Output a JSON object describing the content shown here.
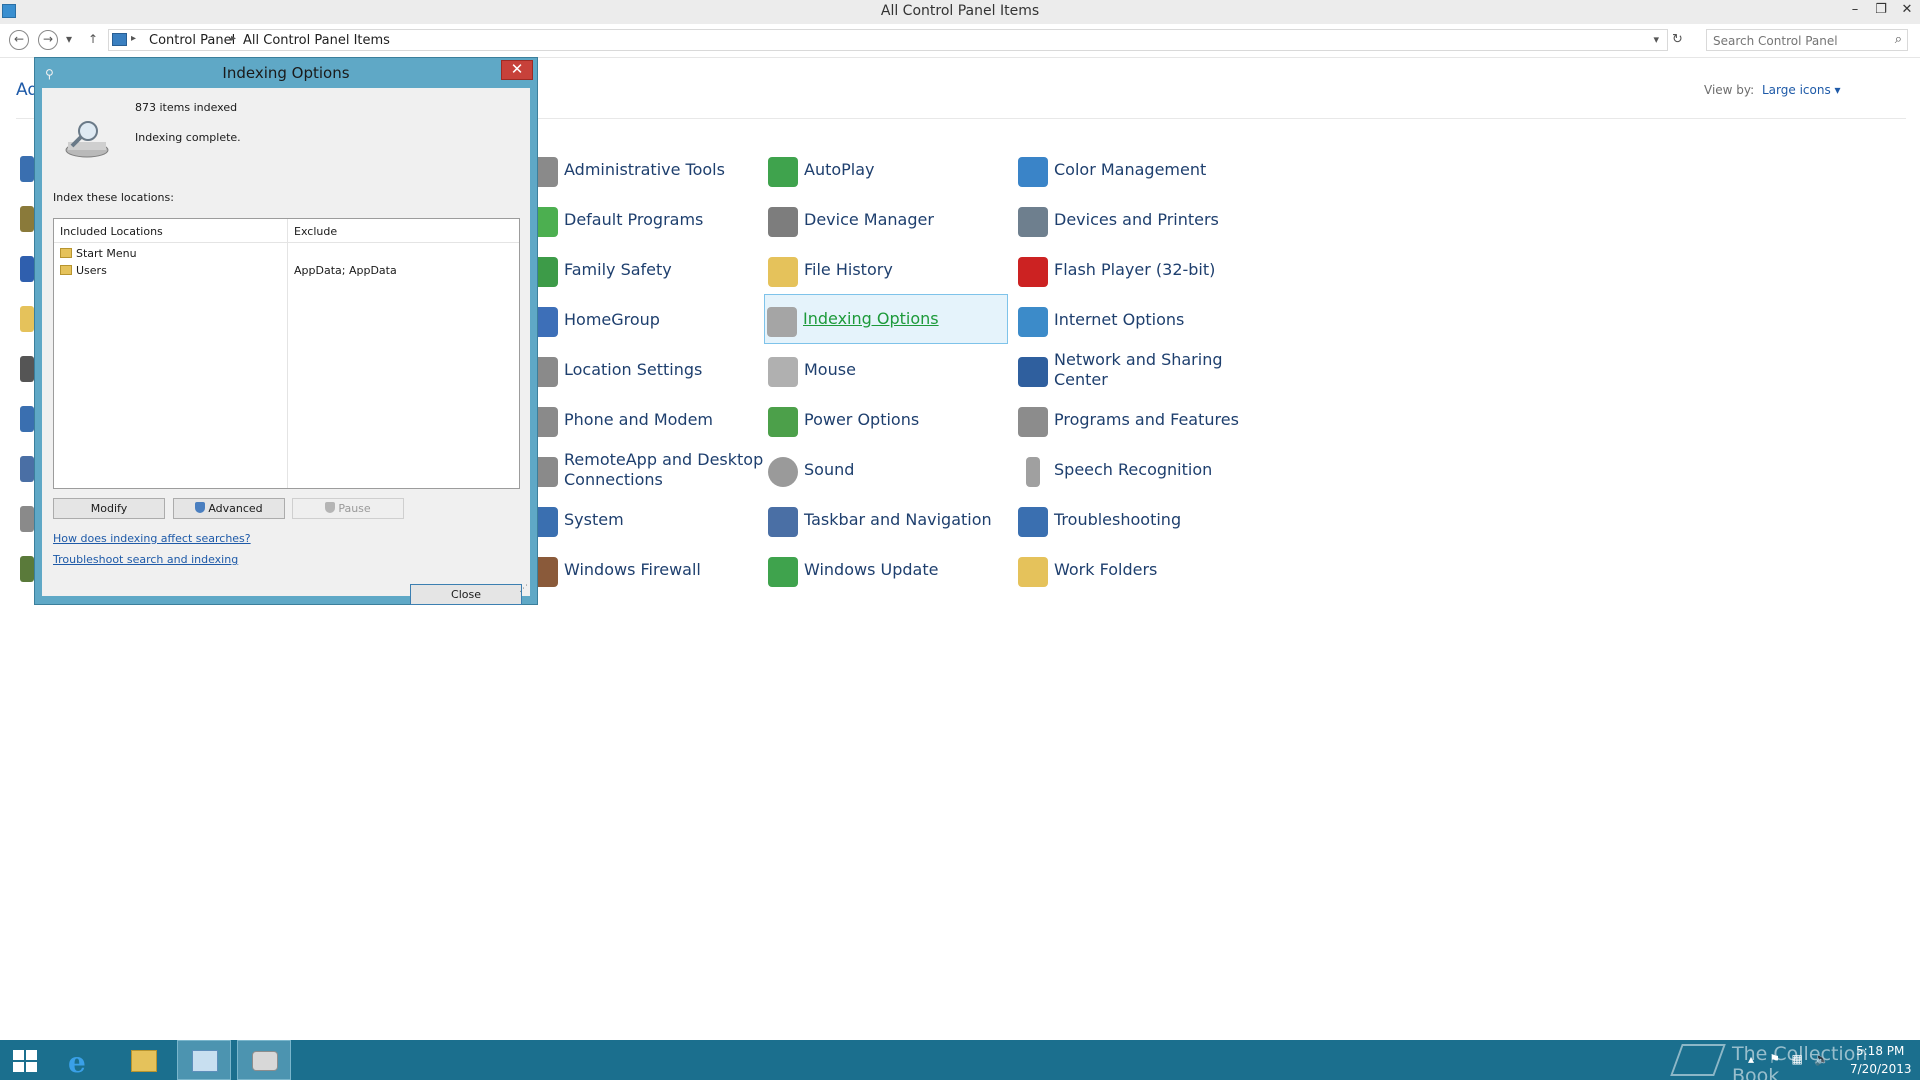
{
  "window": {
    "title": "All Control Panel Items"
  },
  "address": {
    "crumbs": [
      "Control Panel",
      "All Control Panel Items"
    ],
    "search_placeholder": "Search Control Panel"
  },
  "content": {
    "adjust_partial": "Ad",
    "view_by_label": "View by:",
    "view_by_value": "Large icons ▾"
  },
  "items": [
    {
      "label": "Administrative Tools",
      "icon": "administrative-tools-icon",
      "color": "#8a8a8a"
    },
    {
      "label": "AutoPlay",
      "icon": "autoplay-icon",
      "color": "#3fa34d"
    },
    {
      "label": "Color Management",
      "icon": "color-management-icon",
      "color": "#3a84c8"
    },
    {
      "label": "Default Programs",
      "icon": "default-programs-icon",
      "color": "#4caf50"
    },
    {
      "label": "Device Manager",
      "icon": "device-manager-icon",
      "color": "#7d7d7d"
    },
    {
      "label": "Devices and Printers",
      "icon": "printer-icon",
      "color": "#6e7f8e"
    },
    {
      "label": "Family Safety",
      "icon": "family-safety-icon",
      "color": "#3d9b48"
    },
    {
      "label": "File History",
      "icon": "file-history-icon",
      "color": "#e5c25b"
    },
    {
      "label": "Flash Player (32-bit)",
      "icon": "flash-player-icon",
      "color": "#cc2222"
    },
    {
      "label": "HomeGroup",
      "icon": "homegroup-icon",
      "color": "#3d6fb8"
    },
    {
      "label": "Indexing Options",
      "icon": "indexing-options-icon",
      "color": "#a5a5a5"
    },
    {
      "label": "Internet Options",
      "icon": "internet-options-icon",
      "color": "#3c8bc9"
    },
    {
      "label": "Location Settings",
      "icon": "location-settings-icon",
      "color": "#8a8a8a"
    },
    {
      "label": "Mouse",
      "icon": "mouse-icon",
      "color": "#b0b0b0"
    },
    {
      "label": "Network and Sharing Center",
      "icon": "network-icon",
      "color": "#2f5f9e"
    },
    {
      "label": "Phone and Modem",
      "icon": "phone-modem-icon",
      "color": "#8a8a8a"
    },
    {
      "label": "Power Options",
      "icon": "power-options-icon",
      "color": "#4ca04a"
    },
    {
      "label": "Programs and Features",
      "icon": "programs-features-icon",
      "color": "#8c8c8c"
    },
    {
      "label": "RemoteApp and Desktop Connections",
      "icon": "remoteapp-icon",
      "color": "#8a8a8a"
    },
    {
      "label": "Sound",
      "icon": "sound-icon",
      "color": "#9a9a9a"
    },
    {
      "label": "Speech Recognition",
      "icon": "microphone-icon",
      "color": "#a0a0a0"
    },
    {
      "label": "System",
      "icon": "system-icon",
      "color": "#3a6fb0"
    },
    {
      "label": "Taskbar and Navigation",
      "icon": "taskbar-navigation-icon",
      "color": "#4a6fa5"
    },
    {
      "label": "Troubleshooting",
      "icon": "troubleshooting-icon",
      "color": "#3a6fb0"
    },
    {
      "label": "Windows Firewall",
      "icon": "firewall-icon",
      "color": "#8a5a3a"
    },
    {
      "label": "Windows Update",
      "icon": "windows-update-icon",
      "color": "#3fa34d"
    },
    {
      "label": "Work Folders",
      "icon": "work-folders-icon",
      "color": "#e5c25b"
    }
  ],
  "dialog": {
    "title": "Indexing Options",
    "items_indexed": "873 items indexed",
    "status": "Indexing complete.",
    "index_these": "Index these locations:",
    "col_included": "Included Locations",
    "col_exclude": "Exclude",
    "locations": [
      {
        "name": "Start Menu",
        "exclude": ""
      },
      {
        "name": "Users",
        "exclude": "AppData; AppData"
      }
    ],
    "modify_label": "Modify",
    "advanced_label": "Advanced",
    "pause_label": "Pause",
    "link_how": "How does indexing affect searches?",
    "link_troubleshoot": "Troubleshoot search and indexing",
    "close_label": "Close"
  },
  "taskbar": {
    "watermark": "The Collection Book",
    "time": "5:18 PM",
    "date": "7/20/2013"
  }
}
